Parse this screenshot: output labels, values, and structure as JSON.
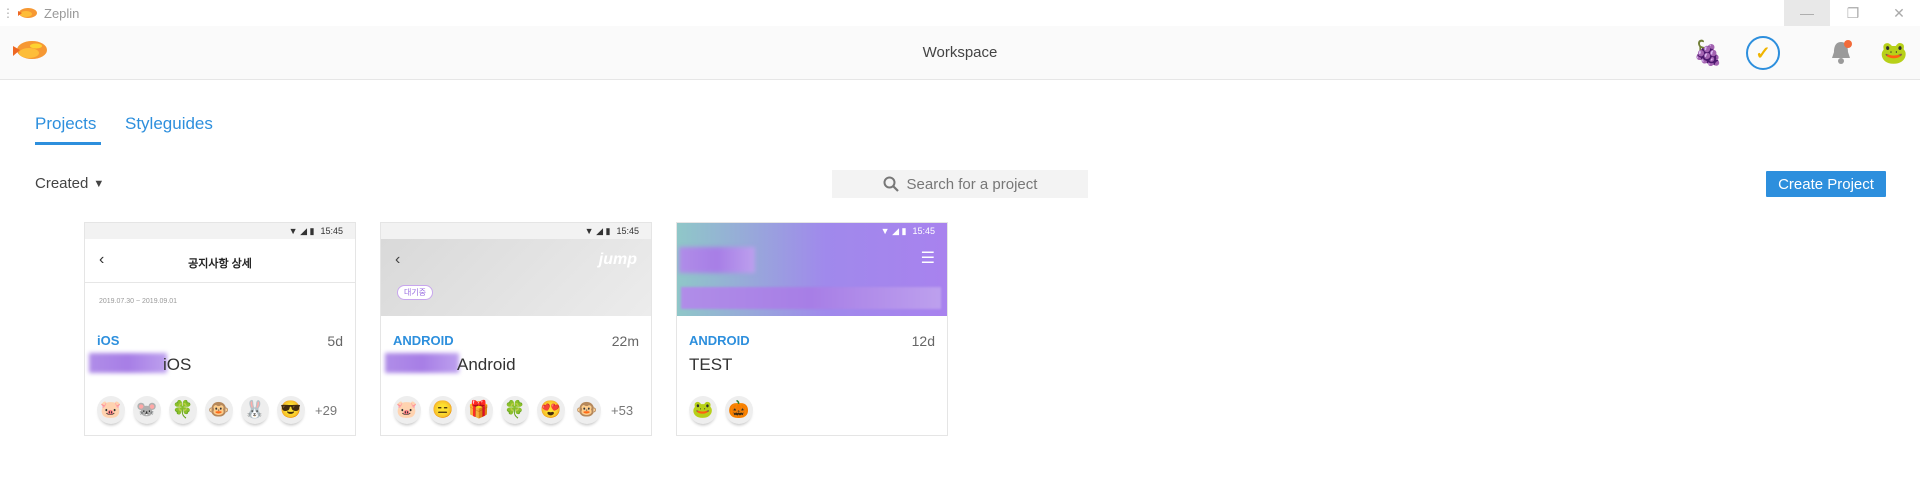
{
  "window": {
    "app_name": "Zeplin",
    "min": "—",
    "max": "❐",
    "close": "✕"
  },
  "header": {
    "title": "Workspace",
    "grapes_icon": "🍇",
    "check_icon": "✓",
    "user_icon": "🐸"
  },
  "tabs": [
    {
      "label": "Projects",
      "active": true
    },
    {
      "label": "Styleguides",
      "active": false
    }
  ],
  "toolbar": {
    "sort_label": "Created",
    "sort_chevron": "⌄",
    "search_placeholder": "Search for a project",
    "create_label": "Create Project"
  },
  "projects": [
    {
      "platform": "iOS",
      "age": "5d",
      "name": "iOS",
      "thumb": {
        "time": "15:45",
        "screen_title": "공지사항 상세",
        "date_range": "2019.07.30 ~ 2019.09.01"
      },
      "avatars": [
        "🐷",
        "🐭",
        "🍀",
        "🐵",
        "🐰",
        "😎"
      ],
      "more": "+29"
    },
    {
      "platform": "ANDROID",
      "age": "22m",
      "name": "Android",
      "thumb": {
        "time": "15:45",
        "brand": "jump",
        "badge": "대기중"
      },
      "avatars": [
        "🐷",
        "😑",
        "🎁",
        "🍀",
        "😍",
        "🐵"
      ],
      "more": "+53"
    },
    {
      "platform": "ANDROID",
      "age": "12d",
      "name": "TEST",
      "thumb": {
        "time": "15:45"
      },
      "avatars": [
        "🐸",
        "🎃"
      ],
      "more": ""
    }
  ],
  "colors": {
    "accent": "#2d8fdd",
    "purple": "#a77ee6"
  }
}
